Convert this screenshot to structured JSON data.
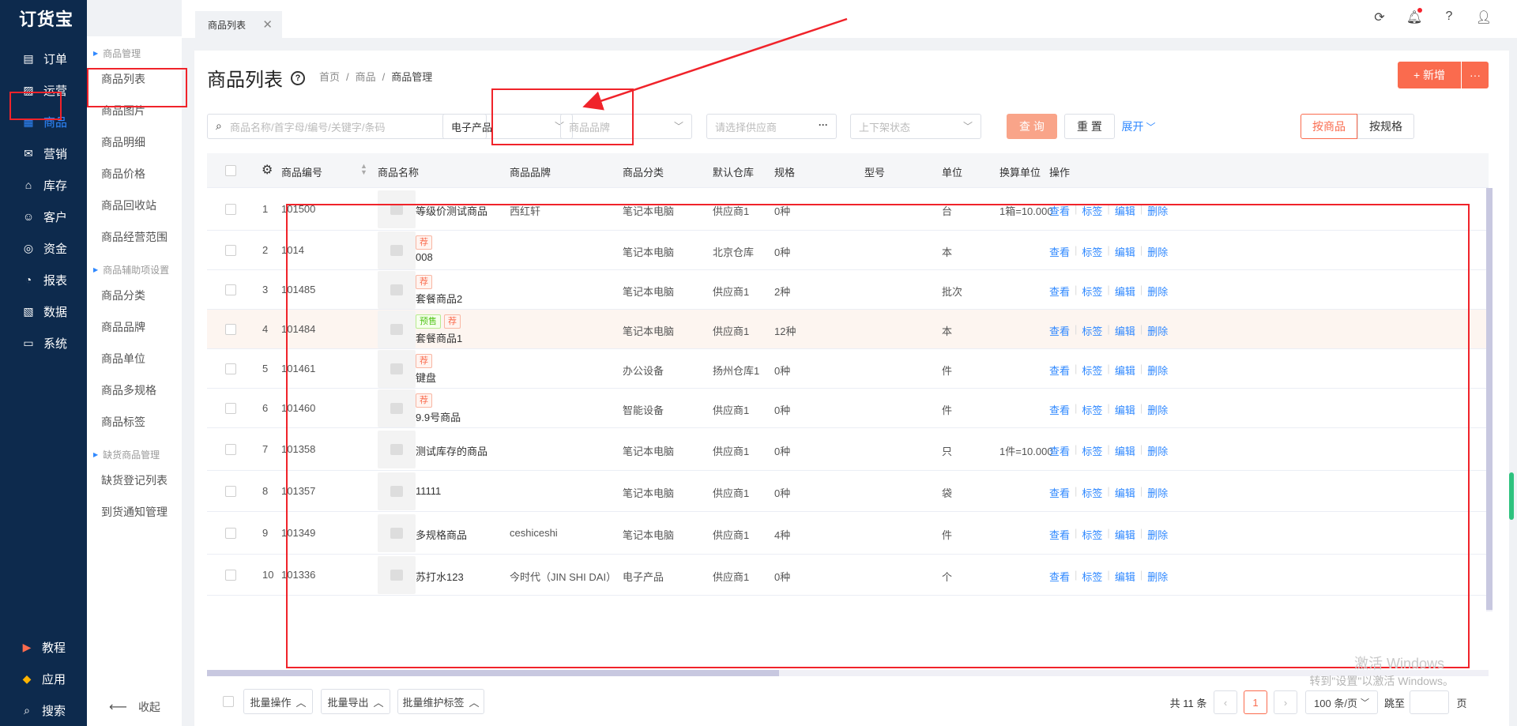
{
  "app": {
    "logo": "订货宝"
  },
  "nav": {
    "items": [
      {
        "label": "订单",
        "icon": "order-icon"
      },
      {
        "label": "运营",
        "icon": "operation-icon"
      },
      {
        "label": "商品",
        "icon": "grid-icon"
      },
      {
        "label": "营销",
        "icon": "marketing-icon"
      },
      {
        "label": "库存",
        "icon": "warehouse-icon"
      },
      {
        "label": "客户",
        "icon": "user-icon"
      },
      {
        "label": "资金",
        "icon": "money-icon"
      },
      {
        "label": "报表",
        "icon": "chart-icon"
      },
      {
        "label": "数据",
        "icon": "data-icon"
      },
      {
        "label": "系统",
        "icon": "monitor-icon"
      }
    ],
    "bottom": [
      {
        "label": "教程",
        "icon": "video-icon"
      },
      {
        "label": "应用",
        "icon": "app-icon"
      },
      {
        "label": "搜索",
        "icon": "search-icon"
      }
    ]
  },
  "subnav": {
    "group1": "商品管理",
    "group1_items": [
      "商品列表",
      "商品图片",
      "商品明细",
      "商品价格",
      "商品回收站",
      "商品经营范围"
    ],
    "group2": "商品辅助项设置",
    "group2_items": [
      "商品分类",
      "商品品牌",
      "商品单位",
      "商品多规格",
      "商品标签"
    ],
    "group3": "缺货商品管理",
    "group3_items": [
      "缺货登记列表",
      "到货通知管理"
    ],
    "collapse": "收起"
  },
  "topbar": {
    "tab_label": "商品列表"
  },
  "page": {
    "title": "商品列表",
    "crumbs": [
      "首页",
      "/",
      "商品",
      "/",
      "商品管理"
    ],
    "new_button": "+ 新增",
    "more_button": "···"
  },
  "filters": {
    "search_placeholder": "商品名称/首字母/编号/关键字/条码",
    "category_value": "电子产品",
    "brand_placeholder": "商品品牌",
    "supplier_placeholder": "请选择供应商",
    "status_placeholder": "上下架状态",
    "query": "查 询",
    "reset": "重 置",
    "expand": "展开",
    "by_product": "按商品",
    "by_spec": "按规格"
  },
  "table": {
    "headers": [
      "商品编号",
      "商品名称",
      "商品品牌",
      "商品分类",
      "默认仓库",
      "规格",
      "型号",
      "单位",
      "换算单位",
      "操作"
    ],
    "ops": [
      "查看",
      "标签",
      "编辑",
      "删除"
    ],
    "rows": [
      {
        "idx": "1",
        "code": "101500",
        "tags": [],
        "name": "等级价测试商品",
        "brand": "西红轩",
        "cat": "笔记本电脑",
        "wh": "供应商1",
        "spec": "0种",
        "unit": "台",
        "conv": "1箱=10.000"
      },
      {
        "idx": "2",
        "code": "1014",
        "tags": [
          "荐"
        ],
        "name": "008",
        "brand": "",
        "cat": "笔记本电脑",
        "wh": "北京仓库",
        "spec": "0种",
        "unit": "本",
        "conv": ""
      },
      {
        "idx": "3",
        "code": "101485",
        "tags": [
          "荐"
        ],
        "name": "套餐商品2",
        "brand": "",
        "cat": "笔记本电脑",
        "wh": "供应商1",
        "spec": "2种",
        "unit": "批次",
        "conv": ""
      },
      {
        "idx": "4",
        "code": "101484",
        "tags": [
          "预售",
          "荐"
        ],
        "name": "套餐商品1",
        "brand": "",
        "cat": "笔记本电脑",
        "wh": "供应商1",
        "spec": "12种",
        "unit": "本",
        "conv": ""
      },
      {
        "idx": "5",
        "code": "101461",
        "tags": [
          "荐"
        ],
        "name": "键盘",
        "brand": "",
        "cat": "办公设备",
        "wh": "扬州仓库1",
        "spec": "0种",
        "unit": "件",
        "conv": ""
      },
      {
        "idx": "6",
        "code": "101460",
        "tags": [
          "荐"
        ],
        "name": "9.9号商品",
        "brand": "",
        "cat": "智能设备",
        "wh": "供应商1",
        "spec": "0种",
        "unit": "件",
        "conv": ""
      },
      {
        "idx": "7",
        "code": "101358",
        "tags": [],
        "name": "测试库存的商品",
        "brand": "",
        "cat": "笔记本电脑",
        "wh": "供应商1",
        "spec": "0种",
        "unit": "只",
        "conv": "1件=10.000"
      },
      {
        "idx": "8",
        "code": "101357",
        "tags": [],
        "name": "11111",
        "brand": "",
        "cat": "笔记本电脑",
        "wh": "供应商1",
        "spec": "0种",
        "unit": "袋",
        "conv": ""
      },
      {
        "idx": "9",
        "code": "101349",
        "tags": [],
        "name": "多规格商品",
        "brand": "ceshiceshi",
        "cat": "笔记本电脑",
        "wh": "供应商1",
        "spec": "4种",
        "unit": "件",
        "conv": ""
      },
      {
        "idx": "10",
        "code": "101336",
        "tags": [],
        "name": "苏打水123",
        "brand": "今时代（JIN SHI DAI）",
        "cat": "电子产品",
        "wh": "供应商1",
        "spec": "0种",
        "unit": "个",
        "conv": ""
      }
    ]
  },
  "footer": {
    "batch_ops": "批量操作",
    "batch_export": "批量导出",
    "batch_tag": "批量维护标签",
    "total": "共 11 条",
    "current_page": "1",
    "page_size": "100 条/页",
    "jump_to": "跳至",
    "page_unit": "页"
  },
  "watermark": {
    "line1": "激活 Windows",
    "line2": "转到\"设置\"以激活 Windows。"
  },
  "colors": {
    "nav_bg": "#0d2a4d",
    "accent": "#2f88ff",
    "primary_btn": "#fa6b4e",
    "annotation": "#f0232a"
  }
}
